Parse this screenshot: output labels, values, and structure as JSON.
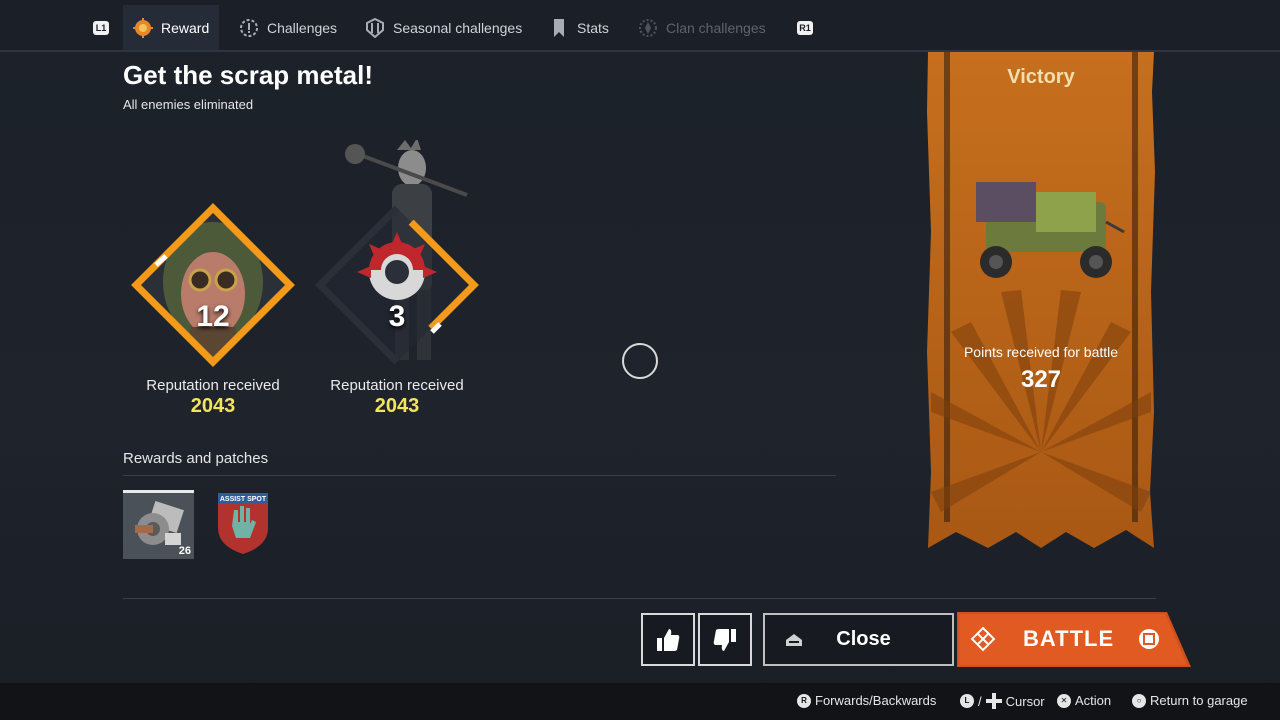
{
  "nav": {
    "left_trigger": "L1",
    "right_trigger": "R1",
    "tabs": [
      {
        "label": "Reward",
        "icon": "reward-icon",
        "state": "active"
      },
      {
        "label": "Challenges",
        "icon": "challenges-icon",
        "state": "normal"
      },
      {
        "label": "Seasonal challenges",
        "icon": "seasonal-icon",
        "state": "normal"
      },
      {
        "label": "Stats",
        "icon": "stats-icon",
        "state": "normal"
      },
      {
        "label": "Clan challenges",
        "icon": "clan-icon",
        "state": "disabled"
      }
    ]
  },
  "main": {
    "title": "Get the scrap metal!",
    "subtitle": "All enemies eliminated",
    "reputation": [
      {
        "level": "12",
        "label": "Reputation received",
        "value": "2043",
        "icon": "player-portrait-icon"
      },
      {
        "level": "3",
        "label": "Reputation received",
        "value": "2043",
        "icon": "faction-emblem-icon"
      }
    ],
    "rewards_title": "Rewards and patches",
    "rewards": [
      {
        "icon": "scrap-metal-icon",
        "count": "26"
      },
      {
        "icon": "assist-patch-icon",
        "text": "ASSIST SPOT"
      }
    ]
  },
  "banner": {
    "title": "Victory",
    "points_label": "Points received for battle",
    "points_value": "327",
    "vehicle_icon": "armored-vehicle-icon"
  },
  "actions": {
    "like": "thumbs-up-icon",
    "dislike": "thumbs-down-icon",
    "close_label": "Close",
    "battle_label": "BATTLE"
  },
  "footer": {
    "hints": [
      {
        "key": "R",
        "label": "Forwards/Backwards"
      },
      {
        "key": "L",
        "label": "Cursor"
      },
      {
        "key": "✕",
        "label": "Action"
      },
      {
        "key": "○",
        "label": "Return to garage"
      }
    ]
  },
  "colors": {
    "accent_orange": "#f39a1b",
    "value_yellow": "#f2e55c",
    "battle_red": "#e05a22",
    "banner_orange": "#c7711c"
  }
}
